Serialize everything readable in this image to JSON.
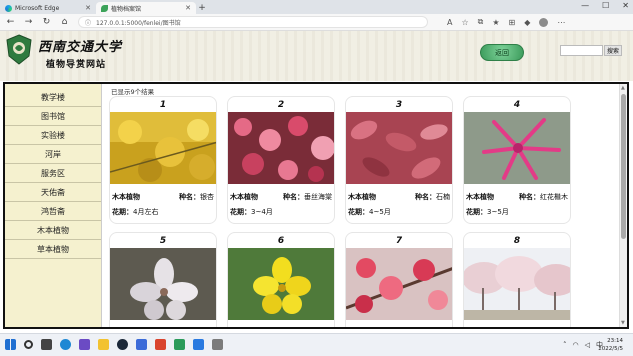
{
  "browser": {
    "tabs": [
      {
        "title": "Microsoft Edge",
        "active": false
      },
      {
        "title": "植物档案馆",
        "active": true
      }
    ],
    "url": "127.0.0.1:5000/fenlei/图书馆"
  },
  "header": {
    "brand_name": "西南交通大学",
    "brand_sub": "植物导赏网站",
    "back_label": "返回",
    "search_placeholder": "",
    "search_label": "搜索"
  },
  "sidebar": {
    "items": [
      {
        "label": "教学楼"
      },
      {
        "label": "图书馆"
      },
      {
        "label": "实验楼"
      },
      {
        "label": "河岸"
      },
      {
        "label": "服务区"
      },
      {
        "label": "天佑斋"
      },
      {
        "label": "鸿哲斋"
      },
      {
        "label": "木本植物"
      },
      {
        "label": "草本植物"
      }
    ]
  },
  "main": {
    "count_text": "已显示9个结果",
    "cards": [
      {
        "number": "1",
        "type": "木本植物",
        "species_label": "种名：",
        "species": "银杏",
        "season_label": "花期：",
        "season": "4月左右",
        "image": "ginkgo-yellow-leaves"
      },
      {
        "number": "2",
        "type": "木本植物",
        "species_label": "种名：",
        "species": "垂丝海棠",
        "season_label": "花期：",
        "season": "3~4月",
        "image": "crabapple-pink-blossoms"
      },
      {
        "number": "3",
        "type": "木本植物",
        "species_label": "种名：",
        "species": "石楠",
        "season_label": "花期：",
        "season": "4~5月",
        "image": "photinia-red-leaves"
      },
      {
        "number": "4",
        "type": "木本植物",
        "species_label": "种名：",
        "species": "红花檵木",
        "season_label": "花期：",
        "season": "3~5月",
        "image": "loropetalum-pink-flower"
      },
      {
        "number": "5",
        "type": "",
        "species_label": "",
        "species": "",
        "season_label": "",
        "season": "",
        "image": "white-pear-blossom"
      },
      {
        "number": "6",
        "type": "",
        "species_label": "",
        "species": "",
        "season_label": "",
        "season": "",
        "image": "yellow-jasmine-flower"
      },
      {
        "number": "7",
        "type": "",
        "species_label": "",
        "species": "",
        "season_label": "",
        "season": "",
        "image": "plum-pink-blossoms"
      },
      {
        "number": "8",
        "type": "",
        "species_label": "",
        "species": "",
        "season_label": "",
        "season": "",
        "image": "cherry-blossom-trees"
      }
    ]
  },
  "taskbar": {
    "time": "23:14",
    "date": "2022/5/5",
    "lang": "中"
  },
  "colors": {
    "sidebar_bg": "#f5f1cf",
    "back_button": "#5bbf7a",
    "frame_border": "#111111"
  }
}
